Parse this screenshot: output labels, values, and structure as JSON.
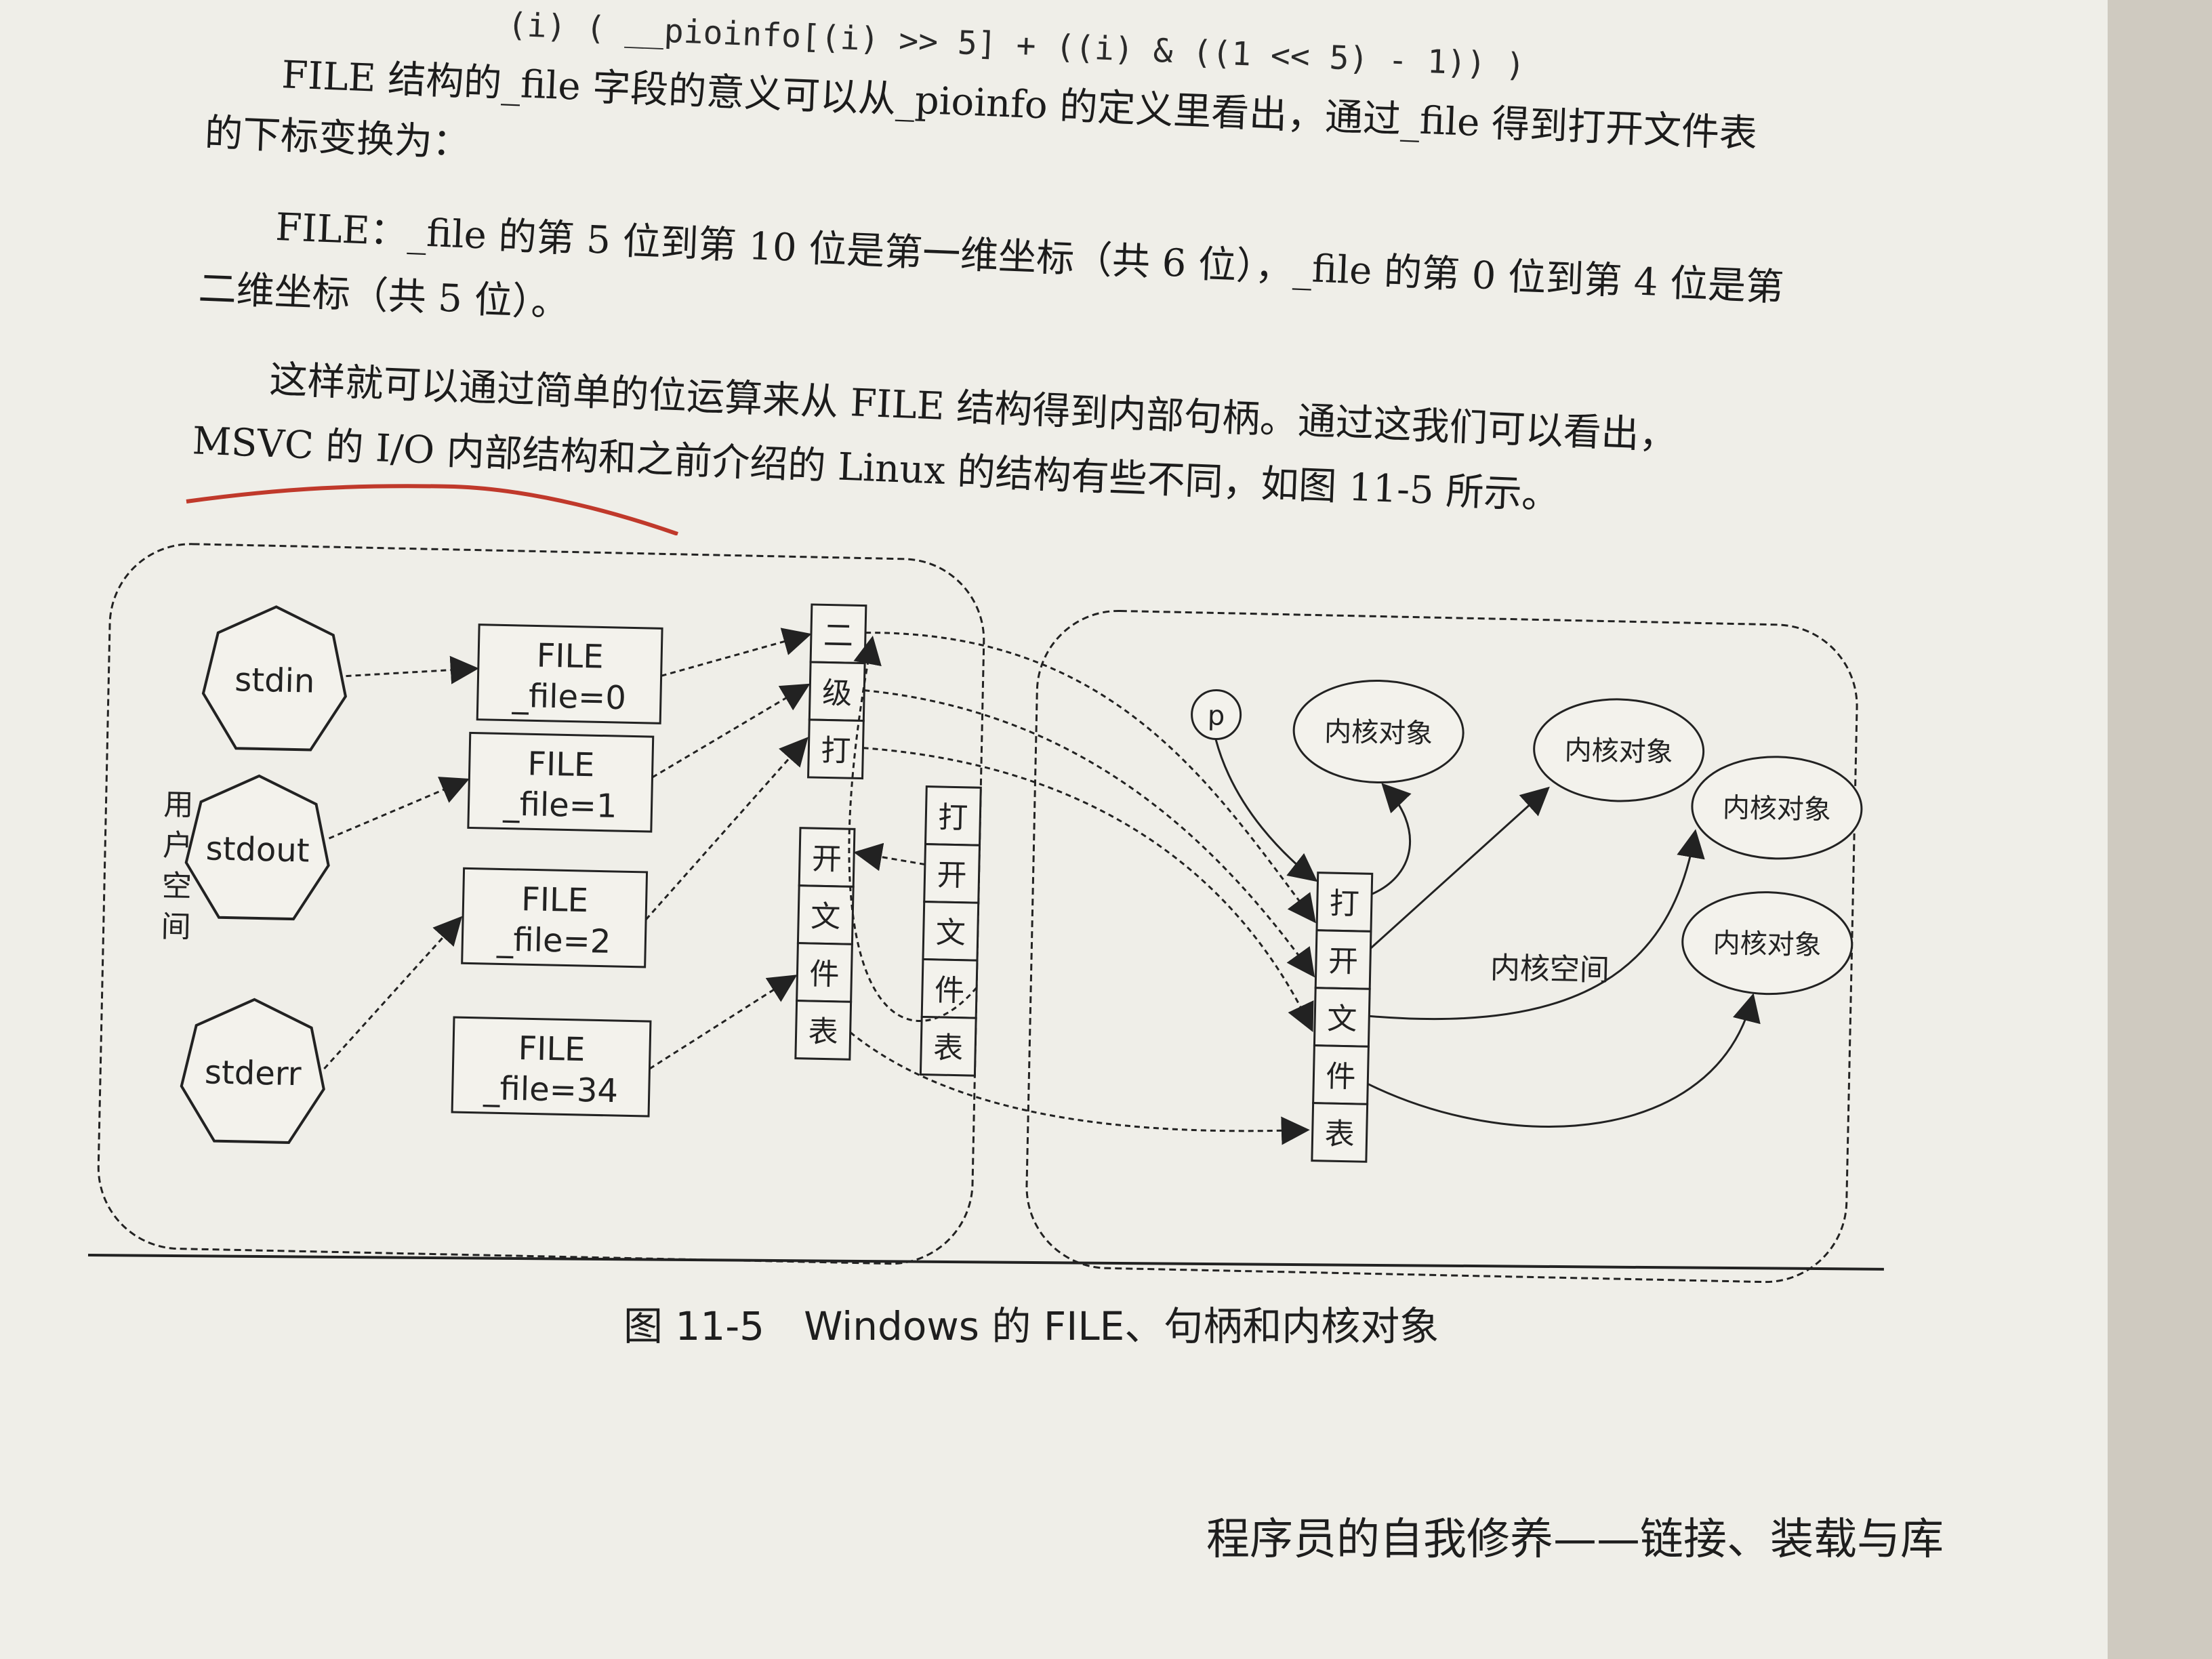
{
  "text": {
    "code_line": "(i) ( __pioinfo[(i) >> 5] + ((i) & ((1 << 5) - 1)) )",
    "line1": "FILE 结构的_file 字段的意义可以从_pioinfo 的定义里看出，通过_file 得到打开文件表",
    "line2": "的下标变换为：",
    "line3": "FILE：_file 的第 5 位到第 10 位是第一维坐标（共 6 位），_file 的第 0 位到第 4 位是第",
    "line4": "二维坐标（共 5 位）。",
    "line5": "这样就可以通过简单的位运算来从 FILE 结构得到内部句柄。通过这我们可以看出，",
    "line6": "MSVC 的 I/O 内部结构和之前介绍的 Linux 的结构有些不同，如图 11-5 所示。"
  },
  "diagram": {
    "user_space_label": "用户空间",
    "kernel_space_label": "内核空间",
    "streams": [
      "stdin",
      "stdout",
      "stderr"
    ],
    "file_title": "FILE",
    "files": [
      "_file=0",
      "_file=1",
      "_file=2",
      "_file=34"
    ],
    "second_level_table": [
      "二",
      "级",
      "打"
    ],
    "open_file_table_small": [
      "开",
      "文",
      "件",
      "表"
    ],
    "open_file_table_user": [
      "打",
      "开",
      "文",
      "件",
      "表"
    ],
    "open_file_table_kernel": [
      "打",
      "开",
      "文",
      "件",
      "表"
    ],
    "pointer_label": "p",
    "kernel_object": "内核对象"
  },
  "caption": "图 11-5　Windows 的 FILE、句柄和内核对象",
  "footer": "程序员的自我修养——链接、装载与库"
}
